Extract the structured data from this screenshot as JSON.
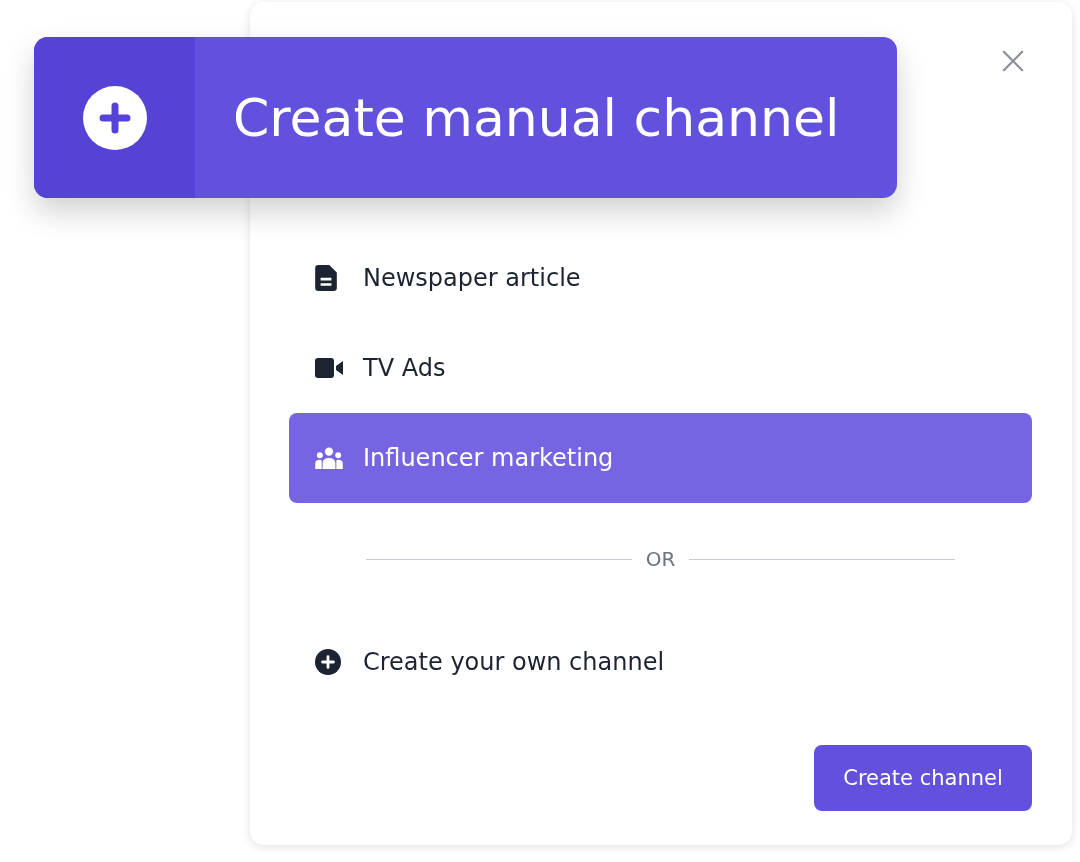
{
  "banner": {
    "title": "Create manual channel"
  },
  "channels": [
    {
      "kind": "document",
      "label": "Newspaper article",
      "selected": false
    },
    {
      "kind": "video",
      "label": "TV Ads",
      "selected": false
    },
    {
      "kind": "people",
      "label": "Influencer marketing",
      "selected": true
    }
  ],
  "divider": {
    "label": "OR"
  },
  "create_own": {
    "label": "Create your own channel"
  },
  "buttons": [
    "Create channel"
  ]
}
